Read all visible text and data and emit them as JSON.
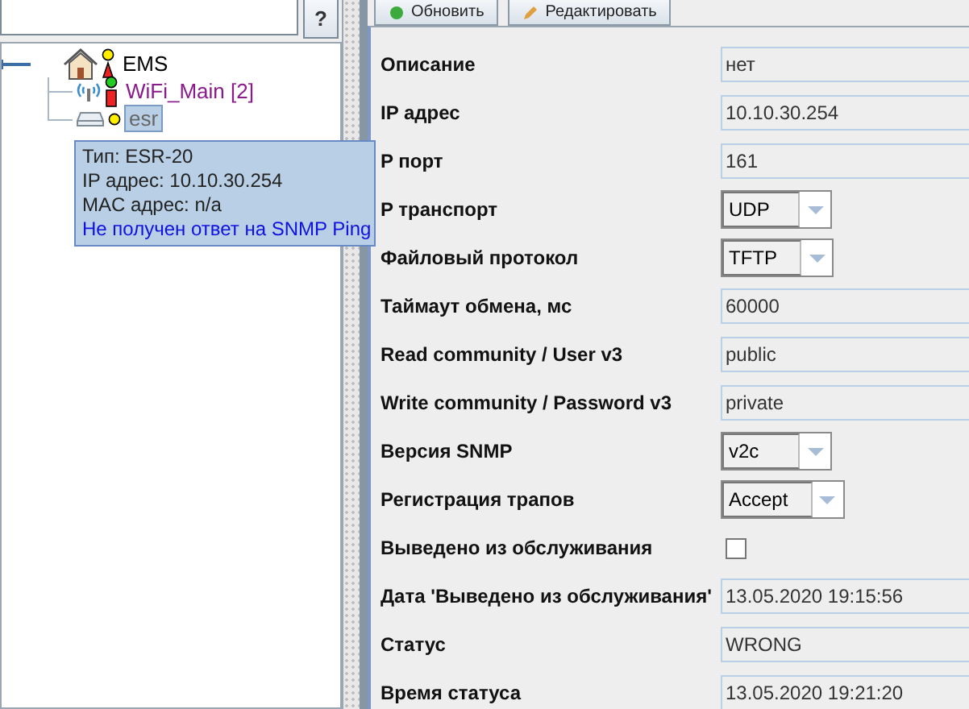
{
  "search": {
    "help_button": "?"
  },
  "toolbar": {
    "buttons": [
      "Обновить",
      "Редактировать"
    ]
  },
  "tree": {
    "label": "EMS",
    "expanded": true,
    "children": [
      {
        "label": "WiFi_Main [2]",
        "kind": "wifi",
        "selected": false
      },
      {
        "label": "esr",
        "kind": "router",
        "selected": true
      }
    ]
  },
  "tooltip": {
    "lines": [
      "Тип: ESR-20",
      "IP адрес: 10.10.30.254",
      "MAC адрес: n/a"
    ],
    "warning": "Не получен ответ на SNMP Ping"
  },
  "form": [
    {
      "label": "Описание",
      "kind": "field",
      "value": "нет"
    },
    {
      "label": "IP адрес",
      "kind": "field",
      "value": "10.10.30.254"
    },
    {
      "label": "P порт",
      "kind": "field",
      "value": "161"
    },
    {
      "label": "P транспорт",
      "kind": "combo",
      "value": "UDP"
    },
    {
      "label": "Файловый протокол",
      "kind": "combo",
      "value": "TFTP"
    },
    {
      "label": "Таймаут обмена, мс",
      "kind": "field",
      "value": "60000"
    },
    {
      "label": "Read community / User v3",
      "kind": "field",
      "value": "public"
    },
    {
      "label": "Write community / Password v3",
      "kind": "field",
      "value": "private"
    },
    {
      "label": "Версия SNMP",
      "kind": "combo",
      "value": "v2c"
    },
    {
      "label": "Регистрация трапов",
      "kind": "combo",
      "value": "Accept"
    },
    {
      "label": "Выведено из обслуживания",
      "kind": "checkbox",
      "checked": false
    },
    {
      "label": "Дата 'Выведено из обслуживания'",
      "kind": "field",
      "value": "13.05.2020 19:15:56"
    },
    {
      "label": "Статус",
      "kind": "field",
      "value": "WRONG"
    },
    {
      "label": "Время статуса",
      "kind": "field",
      "value": "13.05.2020 19:21:20"
    }
  ]
}
